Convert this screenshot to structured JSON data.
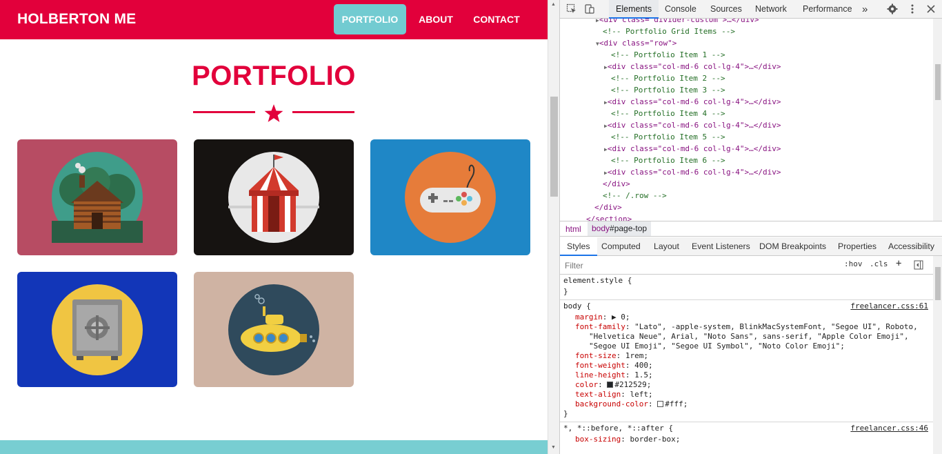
{
  "site": {
    "brand": "HOLBERTON ME",
    "nav": [
      {
        "label": "PORTFOLIO",
        "active": true
      },
      {
        "label": "ABOUT",
        "active": false
      },
      {
        "label": "CONTACT",
        "active": false
      }
    ],
    "heading": "PORTFOLIO",
    "accent": "#e2003b",
    "portfolio": [
      {
        "name": "cabin",
        "bg": "#b74c63",
        "icon": "log-cabin-icon"
      },
      {
        "name": "circus",
        "bg": "#161311",
        "icon": "circus-tent-icon"
      },
      {
        "name": "game",
        "bg": "#1f87c6",
        "icon": "game-controller-icon"
      },
      {
        "name": "safe",
        "bg": "#1236b8",
        "icon": "safe-icon"
      },
      {
        "name": "submarine",
        "bg": "#cfb3a3",
        "icon": "submarine-icon"
      }
    ]
  },
  "devtools": {
    "tabs": [
      "Elements",
      "Console",
      "Sources",
      "Network",
      "Performance"
    ],
    "more": "»",
    "dom": [
      {
        "k": "frag",
        "t": "<div class=\"divider-custom\">…</div>"
      },
      {
        "k": "comment",
        "t": "<!-- Portfolio Grid Items -->"
      },
      {
        "k": "open",
        "t": "<div class=\"row\">"
      },
      {
        "k": "comment",
        "t": "<!-- Portfolio Item 1 -->"
      },
      {
        "k": "item",
        "t": "<div class=\"col-md-6 col-lg-4\">…</div>"
      },
      {
        "k": "comment",
        "t": "<!-- Portfolio Item 2 -->"
      },
      {
        "k": "comment",
        "t": "<!-- Portfolio Item 3 -->"
      },
      {
        "k": "item",
        "t": "<div class=\"col-md-6 col-lg-4\">…</div>"
      },
      {
        "k": "comment",
        "t": "<!-- Portfolio Item 4 -->"
      },
      {
        "k": "item",
        "t": "<div class=\"col-md-6 col-lg-4\">…</div>"
      },
      {
        "k": "comment",
        "t": "<!-- Portfolio Item 5 -->"
      },
      {
        "k": "item",
        "t": "<div class=\"col-md-6 col-lg-4\">…</div>"
      },
      {
        "k": "comment",
        "t": "<!-- Portfolio Item 6 -->"
      },
      {
        "k": "item",
        "t": "<div class=\"col-md-6 col-lg-4\">…</div>"
      },
      {
        "k": "close",
        "t": "</div>"
      },
      {
        "k": "comment",
        "t": "<!-- /.row -->"
      },
      {
        "k": "close",
        "t": "</div>"
      },
      {
        "k": "close",
        "t": "</section>"
      }
    ],
    "breadcrumbs": {
      "html": "html",
      "body_tag": "body",
      "body_id": "#page-top"
    },
    "style_tabs": [
      "Styles",
      "Computed",
      "Layout",
      "Event Listeners",
      "DOM Breakpoints",
      "Properties",
      "Accessibility"
    ],
    "filter_placeholder": "Filter",
    "filter_buttons": [
      ":hov",
      ".cls",
      "+"
    ],
    "element_style": "element.style {",
    "close_brace": "}",
    "body_selector": "body {",
    "body_source": "freelancer.css:61",
    "body_props": [
      {
        "p": "margin",
        "v": "▶ 0;"
      },
      {
        "p": "font-family",
        "v": "\"Lato\", -apple-system, BlinkMacSystemFont, \"Segoe UI\", Roboto,"
      },
      {
        "p": "",
        "v": "\"Helvetica Neue\", Arial, \"Noto Sans\", sans-serif, \"Apple Color Emoji\","
      },
      {
        "p": "",
        "v": "\"Segoe UI Emoji\", \"Segoe UI Symbol\", \"Noto Color Emoji\";"
      },
      {
        "p": "font-size",
        "v": "1rem;"
      },
      {
        "p": "font-weight",
        "v": "400;"
      },
      {
        "p": "line-height",
        "v": "1.5;"
      },
      {
        "p": "color",
        "v": "#212529;",
        "swatch": "#212529"
      },
      {
        "p": "text-align",
        "v": "left;"
      },
      {
        "p": "background-color",
        "v": "#fff;",
        "swatch": "#ffffff"
      }
    ],
    "universal_selector": "*, *::before, *::after {",
    "universal_source": "freelancer.css:46",
    "universal_prop": {
      "p": "box-sizing",
      "v": "border-box;"
    }
  }
}
